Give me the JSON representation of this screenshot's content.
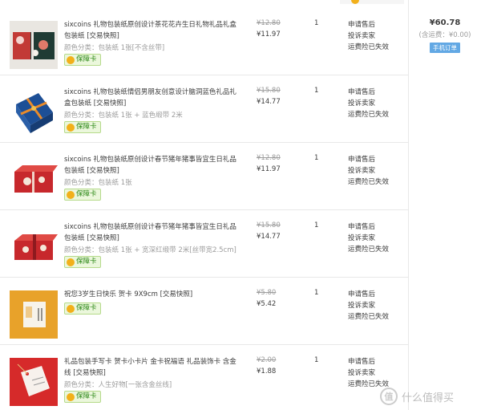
{
  "orders": [
    {
      "title": "sixcoins 礼物包装纸原创设计茶花花卉生日礼物礼品礼盒包装纸 [交易快照]",
      "sku": "颜色分类：包装纸 1张[不含丝带]",
      "badge": "保障卡",
      "price_original": "¥12.80",
      "price_current": "¥11.97",
      "quantity": "1",
      "actions": [
        "申请售后",
        "投诉卖家",
        "运费险已失效"
      ],
      "thumb_icon": "floral-gift-wrap-thumbnail"
    },
    {
      "title": "sixcoins 礼物包装纸情侣男朋友创意设计脑洞蓝色礼品礼盒包装纸 [交易快照]",
      "sku": "颜色分类：包装纸 1张 + 蓝色缎带 2米",
      "badge": "保障卡",
      "price_original": "¥15.80",
      "price_current": "¥14.77",
      "quantity": "1",
      "actions": [
        "申请售后",
        "投诉卖家",
        "运费险已失效"
      ],
      "thumb_icon": "blue-gift-box-thumbnail"
    },
    {
      "title": "sixcoins 礼物包装纸原创设计春节猪年猪事皆宜生日礼品包装纸 [交易快照]",
      "sku": "颜色分类：包装纸 1张",
      "badge": "保障卡",
      "price_original": "¥12.80",
      "price_current": "¥11.97",
      "quantity": "1",
      "actions": [
        "申请售后",
        "投诉卖家",
        "运费险已失效"
      ],
      "thumb_icon": "red-pig-gift-box-thumbnail"
    },
    {
      "title": "sixcoins 礼物包装纸原创设计春节猪年猪事皆宜生日礼品包装纸 [交易快照]",
      "sku": "颜色分类：包装纸 1张 + 宽深红缎带 2米[丝带宽2.5cm]",
      "badge": "保障卡",
      "price_original": "¥15.80",
      "price_current": "¥14.77",
      "quantity": "1",
      "actions": [
        "申请售后",
        "投诉卖家",
        "运费险已失效"
      ],
      "thumb_icon": "red-pig-gift-box-ribbon-thumbnail"
    },
    {
      "title": "祝您3岁生日快乐 贺卡 9X9cm [交易快照]",
      "sku": "",
      "badge": "保障卡",
      "price_original": "¥5.80",
      "price_current": "¥5.42",
      "quantity": "1",
      "actions": [
        "申请售后",
        "投诉卖家",
        "运费险已失效"
      ],
      "thumb_icon": "birthday-card-thumbnail"
    },
    {
      "title": "礼品包装手写卡 贺卡小卡片 金卡祝福语 礼品装饰卡 含金线 [交易快照]",
      "sku": "颜色分类：人生好物[一张含金丝线]",
      "badge": "保障卡",
      "price_original": "¥2.00",
      "price_current": "¥1.88",
      "quantity": "1",
      "actions": [
        "申请售后",
        "投诉卖家",
        "运费险已失效"
      ],
      "thumb_icon": "gift-tag-card-thumbnail"
    }
  ],
  "summary": {
    "total": "¥60.78",
    "shipping": "(含运费：¥0.00)",
    "order_source": "手机订单"
  },
  "watermark": {
    "symbol": "值",
    "text": "什么值得买"
  },
  "colors": {
    "badge_bg": "#ebf7dc",
    "badge_text": "#2f8a1a",
    "order_source_bg": "#62a8e4",
    "strike_price": "#9c9c9c"
  }
}
